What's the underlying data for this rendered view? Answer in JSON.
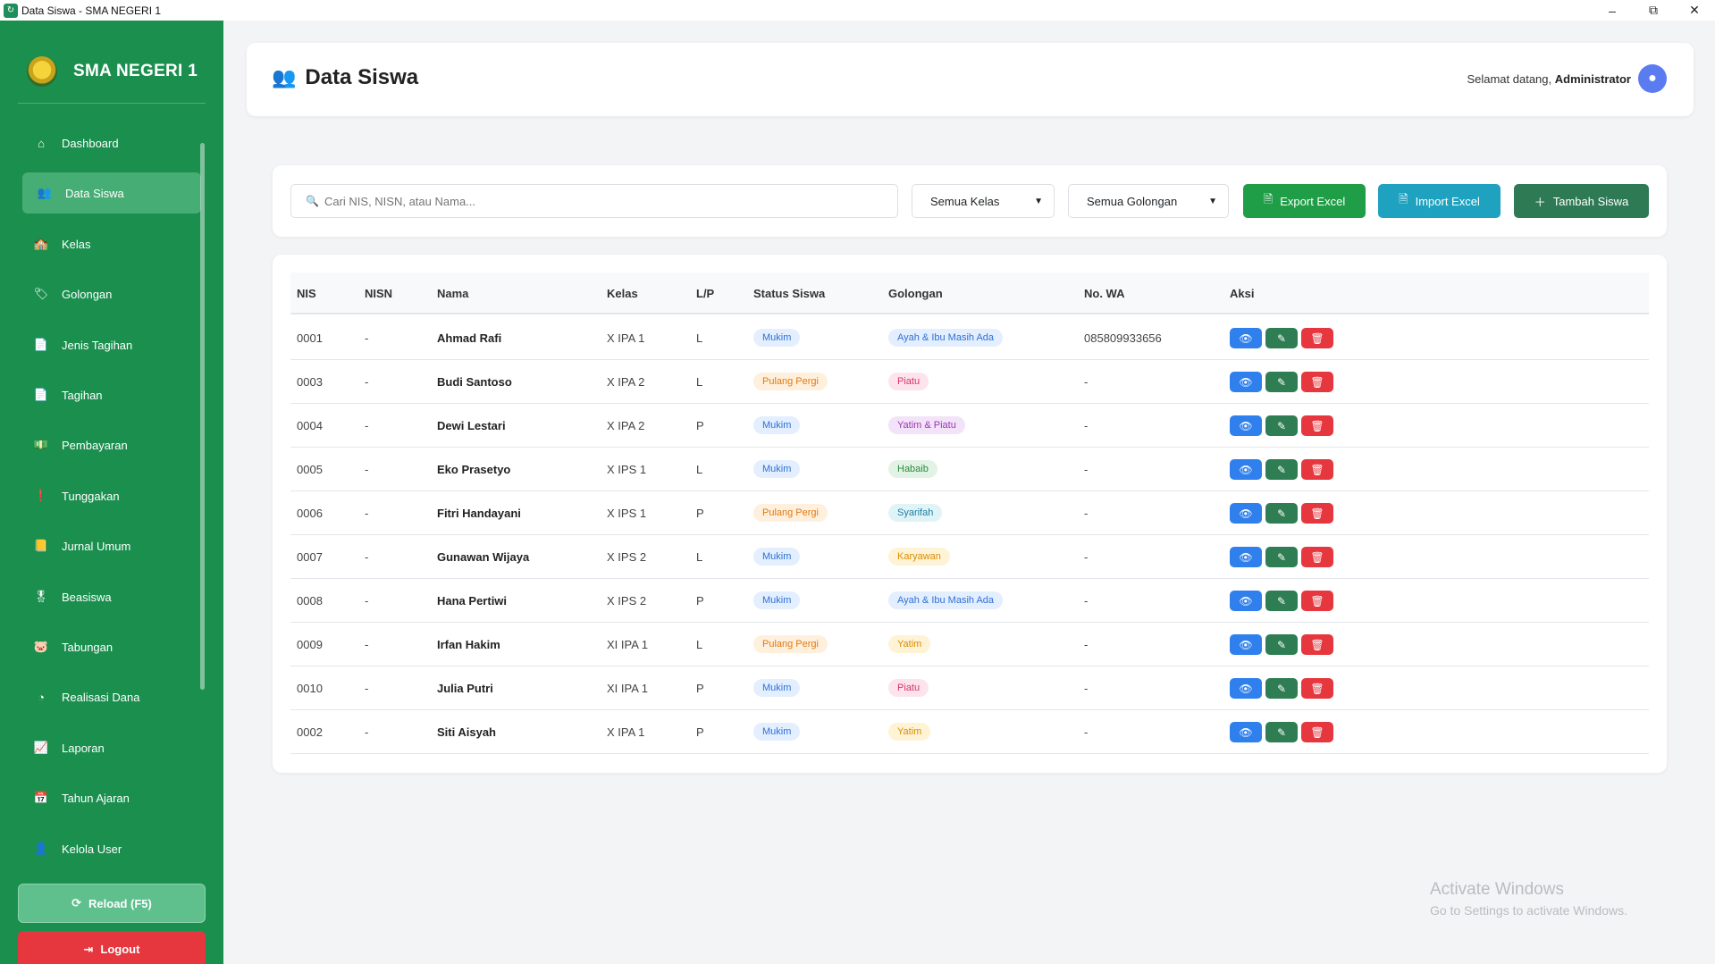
{
  "window": {
    "title": "Data Siswa - SMA NEGERI 1",
    "minimize": "–",
    "maximize": "⧉",
    "close": "✕"
  },
  "sidebar": {
    "brand": "SMA NEGERI 1",
    "items": [
      {
        "label": "Dashboard",
        "icon": "home-icon",
        "glyph": "⌂"
      },
      {
        "label": "Data Siswa",
        "icon": "users-icon",
        "glyph": "👥",
        "active": true
      },
      {
        "label": "Kelas",
        "icon": "school-icon",
        "glyph": "🏫"
      },
      {
        "label": "Golongan",
        "icon": "tag-icon",
        "glyph": "🏷"
      },
      {
        "label": "Jenis Tagihan",
        "icon": "file-icon",
        "glyph": "📄"
      },
      {
        "label": "Tagihan",
        "icon": "invoice-icon",
        "glyph": "📄"
      },
      {
        "label": "Pembayaran",
        "icon": "money-icon",
        "glyph": "💵"
      },
      {
        "label": "Tunggakan",
        "icon": "alert-icon",
        "glyph": "❗"
      },
      {
        "label": "Jurnal Umum",
        "icon": "book-icon",
        "glyph": "📒"
      },
      {
        "label": "Beasiswa",
        "icon": "award-icon",
        "glyph": "🎖"
      },
      {
        "label": "Tabungan",
        "icon": "piggy-bank-icon",
        "glyph": "🐷"
      },
      {
        "label": "Realisasi Dana",
        "icon": "pie-chart-icon",
        "glyph": "◔"
      },
      {
        "label": "Laporan",
        "icon": "chart-icon",
        "glyph": "📈"
      },
      {
        "label": "Tahun Ajaran",
        "icon": "calendar-icon",
        "glyph": "📅"
      },
      {
        "label": "Kelola User",
        "icon": "user-cog-icon",
        "glyph": "👤"
      }
    ],
    "reload_label": "Reload (F5)",
    "logout_label": "Logout"
  },
  "header": {
    "title": "Data Siswa",
    "welcome_prefix": "Selamat datang,",
    "user": "Administrator"
  },
  "filters": {
    "search_placeholder": "Cari NIS, NISN, atau Nama...",
    "kelas": "Semua Kelas",
    "golongan": "Semua Golongan",
    "export_label": "Export Excel",
    "import_label": "Import Excel",
    "add_label": "Tambah Siswa"
  },
  "colors": {
    "sidebar": "#1a8f4e",
    "export": "#1f9d47",
    "import": "#1ea2c0",
    "add": "#2e7a55",
    "view": "#2f80ed",
    "edit": "#2f7d52",
    "delete": "#e6373f"
  },
  "table": {
    "columns": [
      "NIS",
      "NISN",
      "Nama",
      "Kelas",
      "L/P",
      "Status Siswa",
      "Golongan",
      "No. WA",
      "Aksi"
    ],
    "rows": [
      {
        "nis": "0001",
        "nisn": "-",
        "nama": "Ahmad Rafi",
        "kelas": "X IPA 1",
        "lp": "L",
        "status": "Mukim",
        "golongan": "Ayah & Ibu Masih Ada",
        "wa": "085809933656"
      },
      {
        "nis": "0003",
        "nisn": "-",
        "nama": "Budi Santoso",
        "kelas": "X IPA 2",
        "lp": "L",
        "status": "Pulang Pergi",
        "golongan": "Piatu",
        "wa": "-"
      },
      {
        "nis": "0004",
        "nisn": "-",
        "nama": "Dewi Lestari",
        "kelas": "X IPA 2",
        "lp": "P",
        "status": "Mukim",
        "golongan": "Yatim & Piatu",
        "wa": "-"
      },
      {
        "nis": "0005",
        "nisn": "-",
        "nama": "Eko Prasetyo",
        "kelas": "X IPS 1",
        "lp": "L",
        "status": "Mukim",
        "golongan": "Habaib",
        "wa": "-"
      },
      {
        "nis": "0006",
        "nisn": "-",
        "nama": "Fitri Handayani",
        "kelas": "X IPS 1",
        "lp": "P",
        "status": "Pulang Pergi",
        "golongan": "Syarifah",
        "wa": "-"
      },
      {
        "nis": "0007",
        "nisn": "-",
        "nama": "Gunawan Wijaya",
        "kelas": "X IPS 2",
        "lp": "L",
        "status": "Mukim",
        "golongan": "Karyawan",
        "wa": "-"
      },
      {
        "nis": "0008",
        "nisn": "-",
        "nama": "Hana Pertiwi",
        "kelas": "X IPS 2",
        "lp": "P",
        "status": "Mukim",
        "golongan": "Ayah & Ibu Masih Ada",
        "wa": "-"
      },
      {
        "nis": "0009",
        "nisn": "-",
        "nama": "Irfan Hakim",
        "kelas": "XI IPA 1",
        "lp": "L",
        "status": "Pulang Pergi",
        "golongan": "Yatim",
        "wa": "-"
      },
      {
        "nis": "0010",
        "nisn": "-",
        "nama": "Julia Putri",
        "kelas": "XI IPA 1",
        "lp": "P",
        "status": "Mukim",
        "golongan": "Piatu",
        "wa": "-"
      },
      {
        "nis": "0002",
        "nisn": "-",
        "nama": "Siti Aisyah",
        "kelas": "X IPA 1",
        "lp": "P",
        "status": "Mukim",
        "golongan": "Yatim",
        "wa": "-"
      }
    ]
  },
  "watermark": {
    "line1": "Activate Windows",
    "line2": "Go to Settings to activate Windows."
  }
}
